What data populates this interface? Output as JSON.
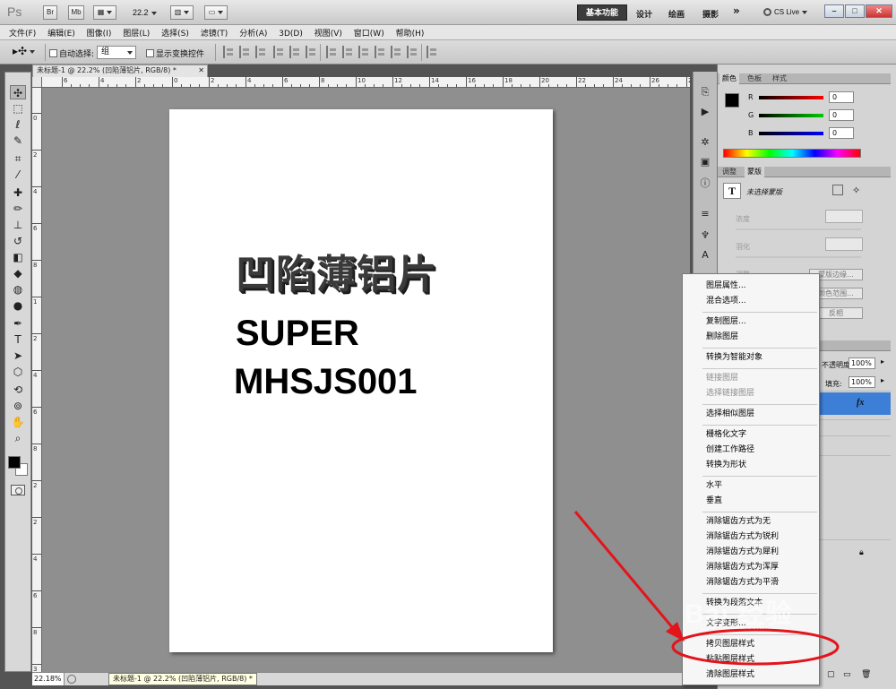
{
  "app": {
    "logo": "Ps",
    "zoom": "22.2",
    "workspaces": {
      "active": "基本功能",
      "others": [
        "设计",
        "绘画",
        "摄影"
      ],
      "more": "»"
    },
    "cs_live": "CS Live",
    "window_controls": [
      "–",
      "□",
      "✕"
    ]
  },
  "menu": [
    "文件(F)",
    "编辑(E)",
    "图像(I)",
    "图层(L)",
    "选择(S)",
    "滤镜(T)",
    "分析(A)",
    "3D(D)",
    "视图(V)",
    "窗口(W)",
    "帮助(H)"
  ],
  "options_bar": {
    "auto_select_label": "自动选择:",
    "auto_select_value": "组",
    "show_transform_label": "显示变换控件"
  },
  "document": {
    "tab_title": "未标题-1 @ 22.2% (凹陷薄铝片, RGB/8) *",
    "tab_close": "✕",
    "ruler_top_labels": [
      "6",
      "4",
      "2",
      "0",
      "2",
      "4",
      "6",
      "8",
      "10",
      "12",
      "14",
      "16",
      "18",
      "20",
      "22",
      "24",
      "26",
      "28"
    ],
    "ruler_left_labels": [
      "0",
      "2",
      "4",
      "6",
      "8",
      "1",
      "2",
      "4",
      "6",
      "8",
      "2",
      "2",
      "4",
      "6",
      "8",
      "3"
    ],
    "canvas_text": {
      "title": "凹陷薄铝片",
      "line1": "SUPER",
      "line2": "MHSJS001"
    },
    "status_zoom": "22.18%",
    "tooltip": "未标题-1 @ 22.2% (凹陷薄铝片, RGB/8) *"
  },
  "color_panel": {
    "tabs": [
      "颜色",
      "色板",
      "样式"
    ],
    "r_label": "R",
    "r_value": "0",
    "g_label": "G",
    "g_value": "0",
    "b_label": "B",
    "b_value": "0"
  },
  "masks_panel": {
    "tabs": [
      "调整",
      "蒙版"
    ],
    "no_mask": "未选择蒙版",
    "density": "浓度",
    "feather": "羽化",
    "adjust_prefix": "调整",
    "mask_edge": "蒙版边缘...",
    "color_range": "颜色范围...",
    "invert": "反相"
  },
  "layers_panel": {
    "opacity_label": "不透明度:",
    "opacity_value": "100%",
    "fill_label": "填充:",
    "fill_value": "100%",
    "fx": "fx"
  },
  "context_menu": {
    "items": [
      {
        "label": "图层属性...",
        "enabled": true
      },
      {
        "label": "混合选项...",
        "enabled": true
      },
      {
        "sep": true
      },
      {
        "label": "复制图层...",
        "enabled": true
      },
      {
        "label": "删除图层",
        "enabled": true
      },
      {
        "sep": true
      },
      {
        "label": "转换为智能对象",
        "enabled": true
      },
      {
        "sep": true
      },
      {
        "label": "链接图层",
        "enabled": false
      },
      {
        "label": "选择链接图层",
        "enabled": false
      },
      {
        "sep": true
      },
      {
        "label": "选择相似图层",
        "enabled": true
      },
      {
        "sep": true
      },
      {
        "label": "栅格化文字",
        "enabled": true
      },
      {
        "label": "创建工作路径",
        "enabled": true
      },
      {
        "label": "转换为形状",
        "enabled": true
      },
      {
        "sep": true
      },
      {
        "label": "水平",
        "enabled": true
      },
      {
        "label": "垂直",
        "enabled": true
      },
      {
        "sep": true
      },
      {
        "label": "消除锯齿方式为无",
        "enabled": true
      },
      {
        "label": "消除锯齿方式为锐利",
        "enabled": true
      },
      {
        "label": "消除锯齿方式为犀利",
        "enabled": true
      },
      {
        "label": "消除锯齿方式为浑厚",
        "enabled": true
      },
      {
        "label": "消除锯齿方式为平滑",
        "enabled": true
      },
      {
        "sep": true
      },
      {
        "label": "转换为段落文本",
        "enabled": true
      },
      {
        "sep": true
      },
      {
        "label": "文字变形...",
        "enabled": true
      },
      {
        "sep": true
      },
      {
        "label": "拷贝图层样式",
        "enabled": true
      },
      {
        "label": "粘贴图层样式",
        "enabled": true
      },
      {
        "label": "清除图层样式",
        "enabled": true
      }
    ]
  },
  "watermark": {
    "text": "Bai 经验",
    "sub": "jingyan.baidu.com"
  },
  "colors": {
    "accent_red": "#e3141b",
    "layer_selected": "#3d7fd6",
    "canvas_bg": "#8f8f8f"
  }
}
